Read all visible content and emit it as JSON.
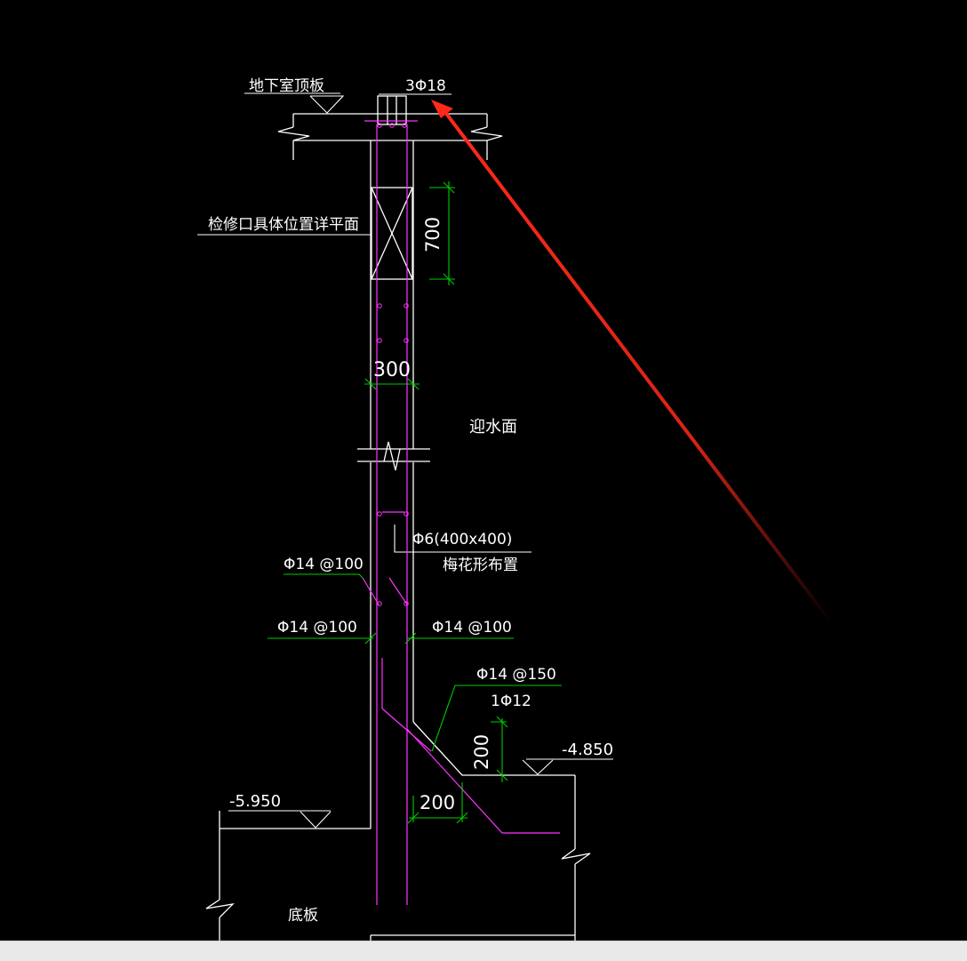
{
  "drawing": {
    "labels": {
      "roof_slab": "地下室顶板",
      "top_bars": "3Φ18",
      "access_hole_note": "检修口具体位置详平面",
      "water_face": "迎水面",
      "tie_bars": "Φ6(400x400)",
      "tie_layout": "梅花形布置",
      "bars_1": "Φ14 @100",
      "bars_2": "Φ14 @100",
      "bars_3": "Φ14 @100",
      "haunch_bars": "Φ14 @150",
      "haunch_extra": "1Φ12",
      "floor_slab": "底板"
    },
    "dimensions": {
      "opening_height": "700",
      "wall_thickness": "300",
      "haunch_height": "200",
      "haunch_width": "200"
    },
    "elevations": {
      "upper": "-4.850",
      "lower": "-5.950"
    }
  },
  "colors": {
    "background": "#000000",
    "outline": "#ffffff",
    "rebar": "#ff33ff",
    "dimension": "#00cc00",
    "annotation_arrow": "#ff2a1a",
    "footer": "#e9e9e9"
  }
}
